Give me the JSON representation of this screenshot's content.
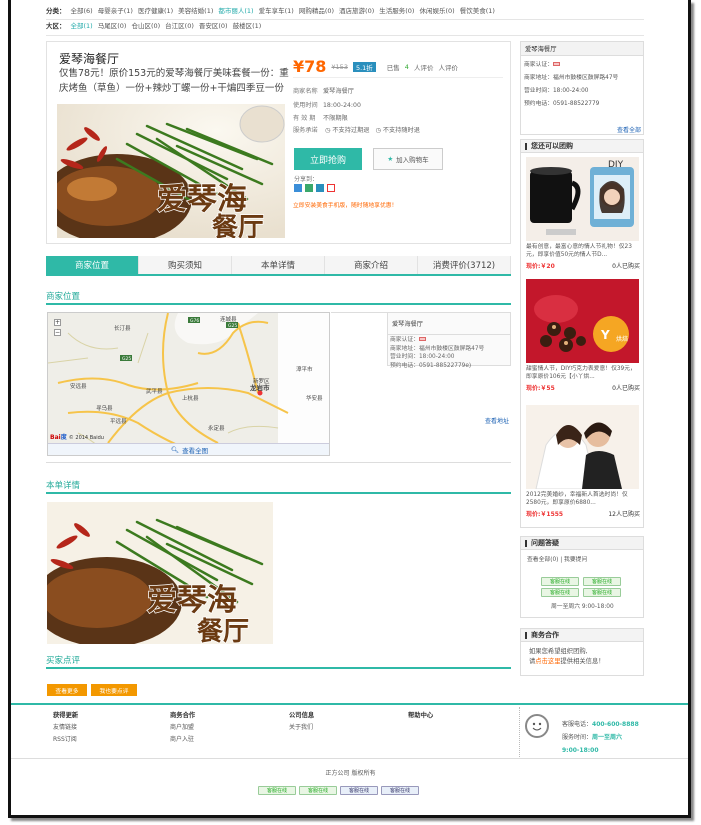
{
  "filters": {
    "category": {
      "label": "分类：",
      "items": [
        "全部(6)",
        "母婴亲子(1)",
        "医疗健康(1)",
        "美容结婚(1)",
        "都市丽人(1)",
        "爱车享车(1)",
        "网购精品(0)",
        "酒店旅游(0)",
        "生活服务(0)",
        "休闲娱乐(0)",
        "餐饮美食(1)"
      ],
      "selected_index": 4
    },
    "district": {
      "label": "大区：",
      "items": [
        "全部(1)",
        "马尾区(0)",
        "仓山区(0)",
        "台江区(0)",
        "晋安区(0)",
        "鼓楼区(1)"
      ],
      "selected_index": 0
    }
  },
  "deal": {
    "title": "爱琴海餐厅",
    "description": "仅售78元！原价153元的爱琴海餐厅美味套餐一份：重庆烤鱼（草鱼）一份+辣炒丁螺一份+干煸四季豆一份",
    "hero_text": "爱琴海餐厅",
    "currency": "¥",
    "price": "¥78",
    "original_price": "¥153",
    "discount": "5.1折",
    "sold_prefix": "已售",
    "sold_count": "4",
    "sold_suffix": "人评价",
    "review_count_suffix": "人评价",
    "merchant_label": "商家名称",
    "merchant_name": "爱琴海餐厅",
    "hours_label": "使用时间",
    "hours": "18:00-24:00",
    "validity_label": "有 效 期",
    "validity": "不限期限",
    "guarantee_label": "服务承诺",
    "guarantee_1": "不支持过期退",
    "guarantee_2": "不支持随时退",
    "buy_label": "立即抢购",
    "cart_label": "加入购物车",
    "share_label": "分享到：",
    "promo_text": "立即安装美食手机版，随时随地享优惠！"
  },
  "tabs": [
    "商家位置",
    "购买须知",
    "本单详情",
    "商家介绍",
    "消费评价(3712)"
  ],
  "sections": {
    "location_title": "商家位置",
    "detail_title": "本单详情",
    "reviews_title": "买家点评",
    "view_map": "查看全图",
    "map_copyright": "© 2014 Baidu",
    "map_places": [
      "连城县",
      "长汀县",
      "龙岩市",
      "永定县",
      "上杭县",
      "武平县",
      "安远县",
      "寻乌县",
      "平远县",
      "华安县",
      "漳平市",
      "新罗区"
    ],
    "view_address": "查看地址",
    "review_more": "查看更多",
    "review_write": "我也要点评"
  },
  "map_info": {
    "title": "爱琴海餐厅",
    "auth": "商家认证：",
    "address": "商家地址：福州市鼓楼区鼓屏路47号",
    "hours": "营业时间：18:00-24:00",
    "phone": "预约电话：0591-88522779e)"
  },
  "sidebar": {
    "merchant": {
      "title": "爱琴海餐厅",
      "auth": "商家认证：",
      "address": "商家地址：福州市鼓楼区鼓屏路47号",
      "hours": "营业时间：18:00-24:00",
      "phone": "预约电话：0591-88522779",
      "more": "查看全部"
    },
    "also_title": "您还可以团购",
    "recommendations": [
      {
        "caption": "最有创意，最富心意的情人节礼物！仅23元，即享价值50元的情人节D...",
        "price": "现价:￥20",
        "buyers": "0人已购买"
      },
      {
        "caption": "甜蜜情人节，DIY巧克力表爱意！仅39元，即享原价106元【小丫烘...",
        "price": "现价:￥55",
        "buyers": "0人已购买"
      },
      {
        "caption": "2012完美婚纱，幸福新人首选时尚！仅2580元，即享原价6880...",
        "price": "现价:￥1555",
        "buyers": "12人已购买"
      }
    ],
    "qa_title": "问题答疑",
    "qa_all": "查看全部(0)",
    "qa_ask": "我要提问",
    "qq_label": "客服在线",
    "qq_hours": "周一至周六 9:00-18:00",
    "coop_title": "商务合作",
    "coop_text_1": "如果您希望组织团购,",
    "coop_text_2a": "请",
    "coop_link": "点击这里",
    "coop_text_2b": "提供相关信息！"
  },
  "footer": {
    "cols": [
      {
        "title": "获得更新",
        "links": [
          "友情链接",
          "RSS订阅"
        ]
      },
      {
        "title": "商务合作",
        "links": [
          "商户加盟",
          "商户入驻"
        ]
      },
      {
        "title": "公司信息",
        "links": [
          "关于我们"
        ]
      },
      {
        "title": "帮助中心",
        "links": []
      }
    ],
    "service_phone_label": "客服电话：",
    "service_phone": "400-600-8888",
    "service_hours_label": "服务时间：",
    "service_days": "周一至周六",
    "service_hours": "9:00-18:00",
    "copyright": "正方公司 版权所有",
    "qq_label": "客服在线"
  },
  "colors": {
    "accent": "#2fb9a7",
    "price": "#ff6600",
    "link": "#1d62b4",
    "button_orange": "#f39800"
  }
}
